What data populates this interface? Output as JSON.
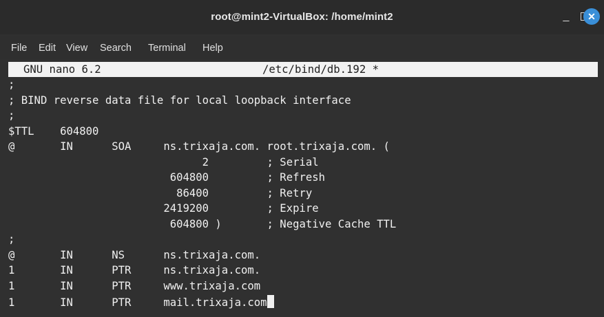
{
  "window": {
    "title": "root@mint2-VirtualBox: /home/mint2",
    "minimize_glyph": "_",
    "close_glyph": "✕"
  },
  "menu": [
    "File",
    "Edit",
    "View",
    "Search",
    "Terminal",
    "Help"
  ],
  "nano": {
    "version": "GNU nano 6.2",
    "filename": "/etc/bind/db.192 *"
  },
  "lines": [
    ";",
    "; BIND reverse data file for local loopback interface",
    ";",
    "$TTL    604800",
    "@       IN      SOA     ns.trixaja.com. root.trixaja.com. (",
    "                              2         ; Serial",
    "                         604800         ; Refresh",
    "                          86400         ; Retry",
    "                        2419200         ; Expire",
    "                         604800 )       ; Negative Cache TTL",
    ";",
    "@       IN      NS      ns.trixaja.com.",
    "1       IN      PTR     ns.trixaja.com.",
    "1       IN      PTR     www.trixaja.com",
    "1       IN      PTR     mail.trixaja.com"
  ]
}
